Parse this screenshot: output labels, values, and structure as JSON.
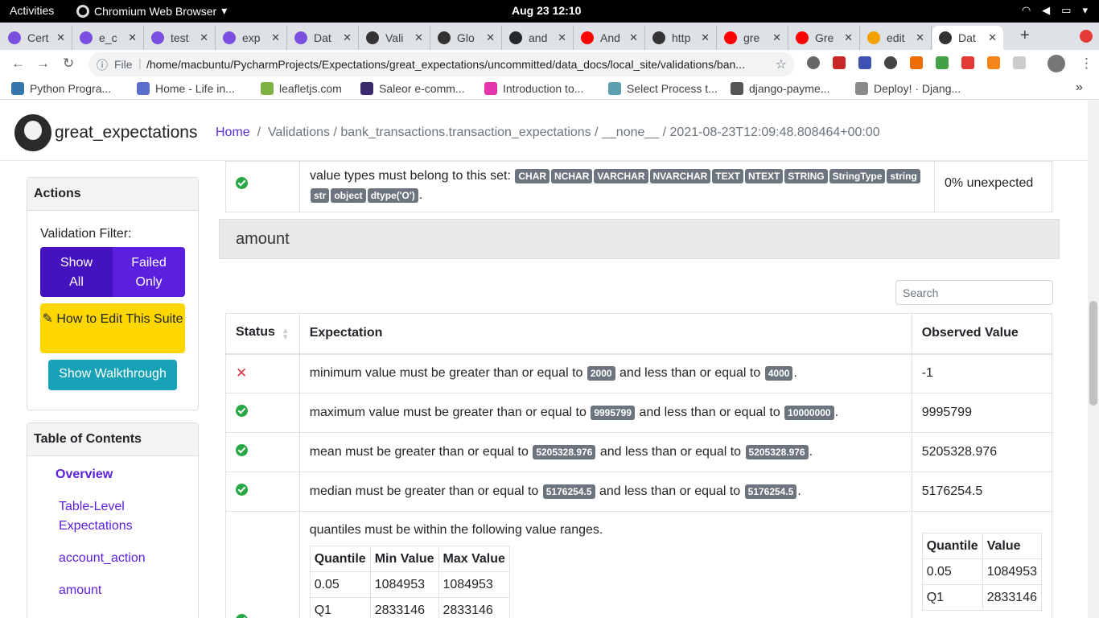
{
  "os": {
    "activities": "Activities",
    "app_name": "Chromium Web Browser",
    "clock": "Aug 23  12:10"
  },
  "tabs": [
    {
      "label": "Cert",
      "icon_color": "#7b4fe0"
    },
    {
      "label": "e_c",
      "icon_color": "#7b4fe0"
    },
    {
      "label": "test",
      "icon_color": "#7b4fe0"
    },
    {
      "label": "exp",
      "icon_color": "#7b4fe0"
    },
    {
      "label": "Dat",
      "icon_color": "#7b4fe0"
    },
    {
      "label": "Vali",
      "icon_color": "#333333"
    },
    {
      "label": "Glo",
      "icon_color": "#333333"
    },
    {
      "label": "and",
      "icon_color": "#24292e"
    },
    {
      "label": "And",
      "icon_color": "#ff0000"
    },
    {
      "label": "http",
      "icon_color": "#333333"
    },
    {
      "label": "gre",
      "icon_color": "#ff0000"
    },
    {
      "label": "Gre",
      "icon_color": "#ff0000"
    },
    {
      "label": "edit",
      "icon_color": "#f4a000"
    },
    {
      "label": "Dat",
      "icon_color": "#333333"
    }
  ],
  "toolbar": {
    "file_label": "File",
    "url": "/home/macbuntu/PycharmProjects/Expectations/great_expectations/uncommitted/data_docs/local_site/validations/ban..."
  },
  "bookmarks": [
    {
      "label": "Python Progra...",
      "icon_color": "#3776ab"
    },
    {
      "label": "Home - Life in...",
      "icon_color": "#5b6dcd"
    },
    {
      "label": "leafletjs.com",
      "icon_color": "#7cb342"
    },
    {
      "label": "Saleor e-comm...",
      "icon_color": "#3a2a6e"
    },
    {
      "label": "Introduction to...",
      "icon_color": "#e535ab"
    },
    {
      "label": "Select Process t...",
      "icon_color": "#5aa0b0"
    },
    {
      "label": "django-payme...",
      "icon_color": "#555555"
    },
    {
      "label": "Deploy! · Djang...",
      "icon_color": "#8a8a8a"
    }
  ],
  "site": {
    "brand": "great_expectations",
    "breadcrumb_home": "Home",
    "breadcrumb_rest": "Validations / bank_transactions.transaction_expectations / __none__ / 2021-08-23T12:09:48.808464+00:00"
  },
  "sidebar": {
    "actions_title": "Actions",
    "filter_label": "Validation Filter:",
    "show_all": "Show All",
    "failed_only": "Failed Only",
    "edit_suite": "How to Edit This Suite",
    "walkthrough": "Show Walkthrough",
    "toc_title": "Table of Contents",
    "toc": [
      "Overview",
      "Table-Level Expectations",
      "account_action",
      "amount"
    ]
  },
  "prev_row": {
    "text": "value types must belong to this set:",
    "badges": [
      "CHAR",
      "NCHAR",
      "VARCHAR",
      "NVARCHAR",
      "TEXT",
      "NTEXT",
      "STRING",
      "StringType",
      "string",
      "str",
      "object",
      "dtype('O')"
    ],
    "observed": "0% unexpected"
  },
  "section_title": "amount",
  "search_placeholder": "Search",
  "table": {
    "headers": [
      "Status",
      "Expectation",
      "Observed Value"
    ],
    "rows": [
      {
        "status": "fail",
        "pre": "minimum value must be greater than or equal to",
        "v1": "2000",
        "mid": "and less than or equal to",
        "v2": "4000",
        "observed": "-1"
      },
      {
        "status": "pass",
        "pre": "maximum value must be greater than or equal to",
        "v1": "9995799",
        "mid": "and less than or equal to",
        "v2": "10000000",
        "observed": "9995799"
      },
      {
        "status": "pass",
        "pre": "mean must be greater than or equal to",
        "v1": "5205328.976",
        "mid": "and less than or equal to",
        "v2": "5205328.976",
        "observed": "5205328.976"
      },
      {
        "status": "pass",
        "pre": "median must be greater than or equal to",
        "v1": "5176254.5",
        "mid": "and less than or equal to",
        "v2": "5176254.5",
        "observed": "5176254.5"
      }
    ],
    "quantile_row": {
      "text": "quantiles must be within the following value ranges.",
      "headers": [
        "Quantile",
        "Min Value",
        "Max Value"
      ],
      "rows": [
        [
          "0.05",
          "1084953",
          "1084953"
        ],
        [
          "Q1",
          "2833146",
          "2833146"
        ]
      ],
      "observed_headers": [
        "Quantile",
        "Value"
      ],
      "observed_rows": [
        [
          "0.05",
          "1084953"
        ],
        [
          "Q1",
          "2833146"
        ]
      ]
    }
  }
}
